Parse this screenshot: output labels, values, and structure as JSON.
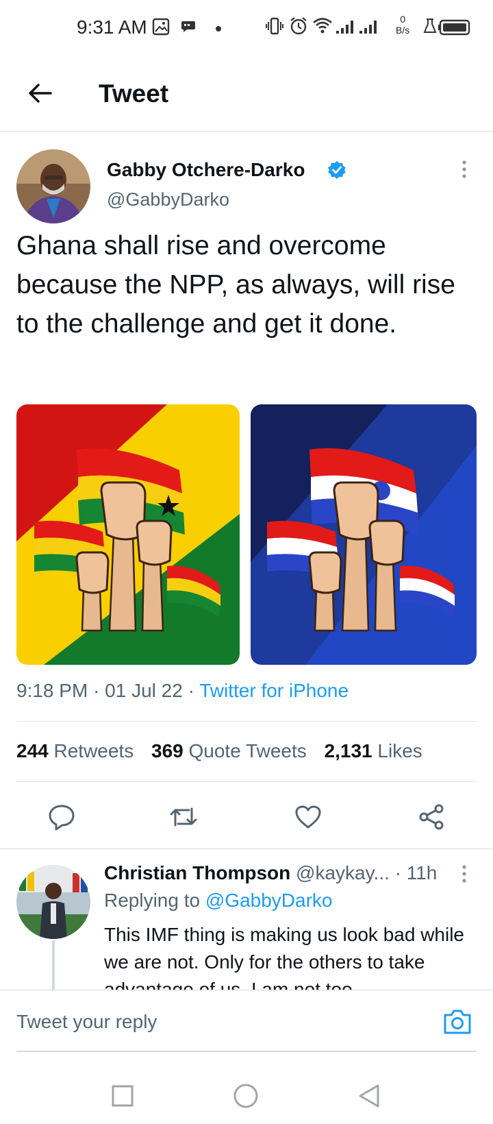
{
  "status_bar": {
    "time": "9:31 AM",
    "net_rate_value": "0",
    "net_rate_unit": "B/s",
    "icons": [
      "image-icon",
      "message-icon",
      "dot-icon",
      "vibrate-icon",
      "alarm-icon",
      "wifi-icon",
      "signal-icon",
      "signal-icon",
      "lab-icon",
      "battery-icon"
    ]
  },
  "header": {
    "title": "Tweet",
    "back_icon": "arrow-left-icon"
  },
  "tweet": {
    "author_name": "Gabby Otchere-Darko",
    "author_handle": "@GabbyDarko",
    "verified": true,
    "text": "Ghana shall rise and overcome because the NPP, as always, will rise to the challenge and get it done.",
    "media": [
      "ghana-flag-fists-image",
      "npp-flag-fists-image"
    ],
    "time": "9:18 PM",
    "date": "01 Jul 22",
    "sep": " · ",
    "source": "Twitter for iPhone",
    "stats": {
      "retweets_count": "244",
      "retweets_label": "Retweets",
      "quotes_count": "369",
      "quotes_label": "Quote Tweets",
      "likes_count": "2,131",
      "likes_label": "Likes"
    },
    "actions": [
      "reply-icon",
      "retweet-icon",
      "like-icon",
      "share-icon"
    ]
  },
  "reply": {
    "name": "Christian Thompson",
    "handle": "@kaykay...",
    "time": "· 11h",
    "replying_prefix": "Replying to",
    "replying_to": "@GabbyDarko",
    "text": "This IMF thing is making us look bad while we are not. Only for the others to take advantage of us. I am not too"
  },
  "compose": {
    "placeholder": "Tweet your reply",
    "camera_icon": "camera-icon"
  },
  "colors": {
    "accent": "#1d9bf0",
    "text": "#0f1419",
    "secondary": "#536471"
  }
}
